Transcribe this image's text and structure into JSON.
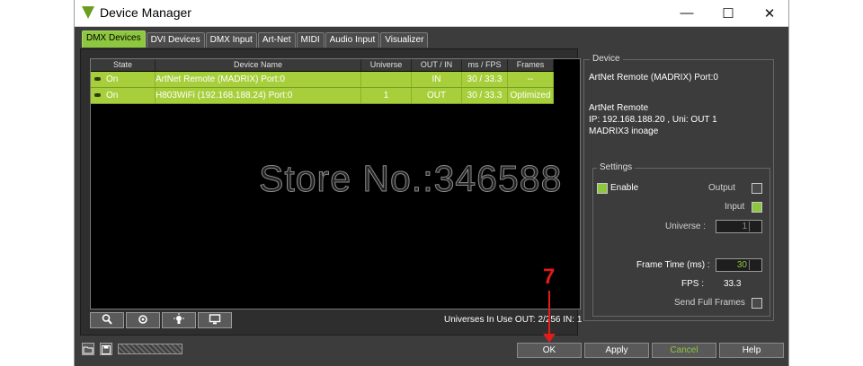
{
  "window": {
    "title": "Device Manager",
    "controls": {
      "minimize": "—",
      "maximize": "☐",
      "close": "✕"
    }
  },
  "tabs": [
    "DMX Devices",
    "DVI Devices",
    "DMX Input",
    "Art-Net",
    "MIDI",
    "Audio Input",
    "Visualizer"
  ],
  "active_tab": "DMX Devices",
  "table": {
    "columns": [
      "State",
      "Device Name",
      "Universe",
      "OUT / IN",
      "ms / FPS",
      "Frames"
    ],
    "rows": [
      {
        "state": "On",
        "name": "ArtNet Remote (MADRIX) Port:0",
        "universe": "",
        "io": "IN",
        "ms": "30 / 33.3",
        "frames": "--"
      },
      {
        "state": "On",
        "name": "H803WiFi (192.168.188.24) Port:0",
        "universe": "1",
        "io": "OUT",
        "ms": "30 / 33.3",
        "frames": "Optimized"
      }
    ]
  },
  "toolbar_icons": [
    "search-icon",
    "settings-icon",
    "light-icon",
    "monitor-icon"
  ],
  "universes_info": "Universes In Use OUT: 2/256 IN: 1",
  "device_panel": {
    "legend": "Device",
    "name": "ArtNet Remote (MADRIX) Port:0",
    "info_lines": [
      "ArtNet Remote",
      "IP: 192.168.188.20 , Uni: OUT 1",
      "MADRIX3 inoage"
    ]
  },
  "settings": {
    "legend": "Settings",
    "enable_label": "Enable",
    "output_label": "Output",
    "input_label": "Input",
    "universe_label": "Universe :",
    "universe_value": "1",
    "frame_time_label": "Frame Time (ms) :",
    "frame_time_value": "30",
    "fps_label": "FPS :",
    "fps_value": "33.3",
    "send_full_frames_label": "Send Full Frames"
  },
  "buttons": {
    "ok": "OK",
    "apply": "Apply",
    "cancel": "Cancel",
    "help": "Help"
  },
  "watermark": "Store No.:346588",
  "annotation": {
    "step": "7",
    "color": "#e21b1b"
  },
  "colors": {
    "accent": "#8dc63f",
    "row": "#a7cf3b",
    "window_bg": "#3c3c3c"
  }
}
